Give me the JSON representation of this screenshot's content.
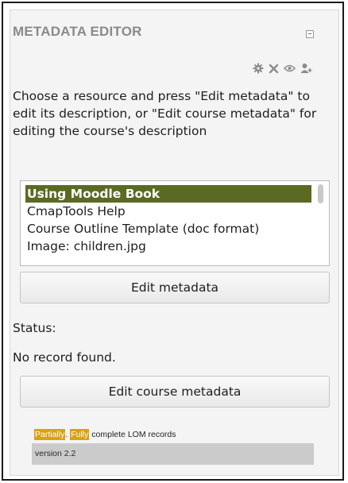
{
  "block": {
    "title": "METADATA EDITOR",
    "controls": {
      "collapse_icon": "collapse-minus-icon",
      "edit_icons": [
        "gear-icon",
        "delete-icon",
        "eye-icon",
        "assign-roles-icon"
      ]
    }
  },
  "instructions": "Choose a resource and press \"Edit metadata\" to edit its description, or \"Edit course metadata\" for editing the course's description",
  "resources": {
    "selected_index": 0,
    "items": [
      {
        "label": "Using Moodle Book"
      },
      {
        "label": "CmapTools Help"
      },
      {
        "label": "Course Outline Template (doc format)"
      },
      {
        "label": "Image: children.jpg"
      }
    ]
  },
  "buttons": {
    "edit_metadata": "Edit metadata",
    "edit_course_metadata": "Edit course metadata"
  },
  "status": {
    "label": "Status:",
    "value": "No record found."
  },
  "legend": {
    "partially": "Partially",
    "separator": ".",
    "fully": "Fully",
    "text": "complete LOM records"
  },
  "version": "version 2.2",
  "colors": {
    "selected_background": "#5b6a23",
    "legend_tag": "#d9a20f",
    "title": "#8a8a8a"
  }
}
